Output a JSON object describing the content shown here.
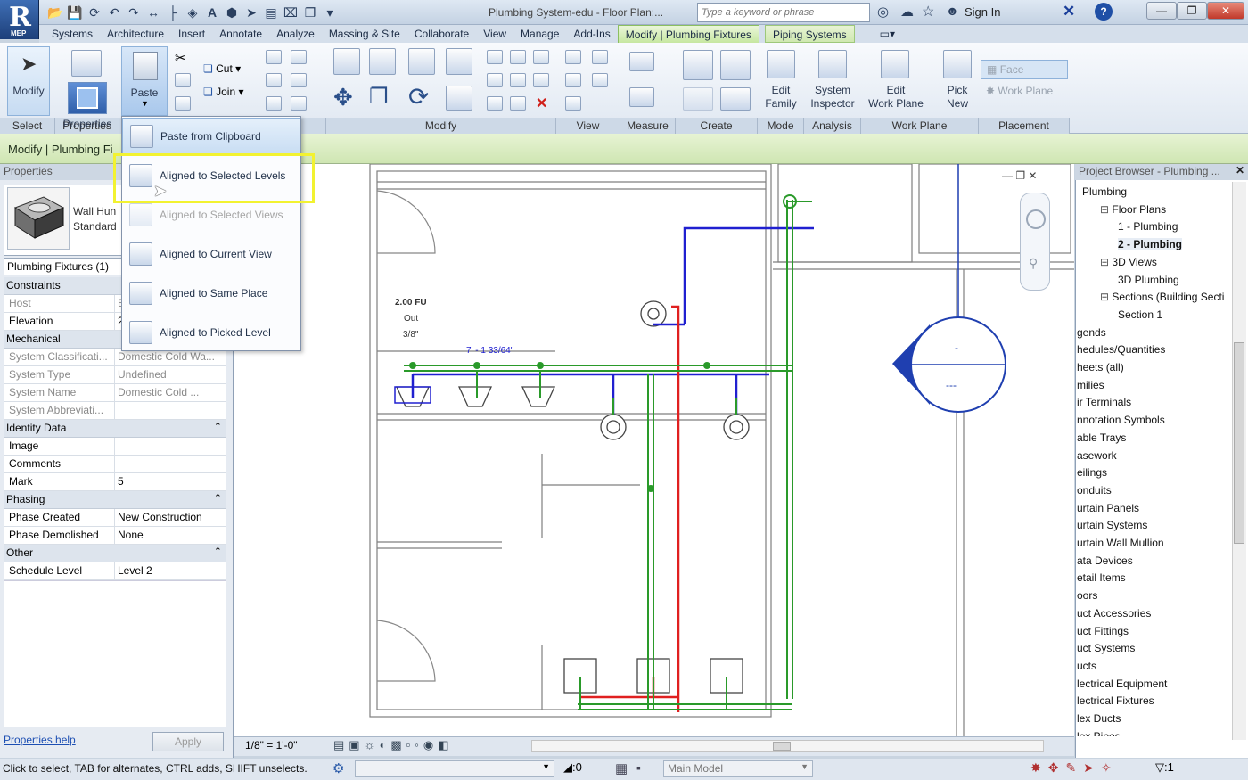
{
  "app": {
    "logo_letter": "R",
    "logo_caption": "MEP"
  },
  "title_bar": {
    "document_title": "Plumbing System-edu - Floor Plan:...",
    "search_placeholder": "Type a keyword or phrase",
    "sign_in": "Sign In",
    "qat_icons": [
      "open-icon",
      "save-icon",
      "sync-icon",
      "undo-icon",
      "redo-icon",
      "measure-icon",
      "dimension-icon",
      "tag-icon",
      "text-icon",
      "3d-view-icon",
      "section-icon",
      "thin-lines-icon",
      "close-hidden-icon",
      "switch-windows-icon",
      "customize-icon"
    ]
  },
  "tabs": [
    "Systems",
    "Architecture",
    "Insert",
    "Annotate",
    "Analyze",
    "Massing & Site",
    "Collaborate",
    "View",
    "Manage",
    "Add-Ins"
  ],
  "context_tabs": {
    "active": "Modify | Plumbing Fixtures",
    "secondary": "Piping Systems"
  },
  "ribbon": {
    "select": {
      "modify": "Modify",
      "label": "Select"
    },
    "properties": {
      "button": "Properties",
      "label": "Properties"
    },
    "clipboard": {
      "paste": "Paste",
      "cut": "Cut",
      "join": "Join"
    },
    "panels": {
      "modify": "Modify",
      "view": "View",
      "measure": "Measure",
      "create": "Create",
      "mode": "Mode",
      "analysis": "Analysis",
      "work_plane": "Work Plane",
      "placement": "Placement"
    },
    "mode_btn": [
      "Edit",
      "Family"
    ],
    "analysis_btn": [
      "System",
      "Inspector"
    ],
    "workplane_btn": [
      "Edit",
      "Work Plane"
    ],
    "pick_btn": [
      "Pick",
      "New"
    ],
    "placement_face": "Face",
    "placement_workplane": "Work Plane"
  },
  "options_bar": {
    "title": "Modify | Plumbing Fi"
  },
  "paste_menu": {
    "items": [
      {
        "label": "Paste from Clipboard",
        "enabled": true
      },
      {
        "label": "Aligned to Selected Levels",
        "enabled": true
      },
      {
        "label": "Aligned to Selected Views",
        "enabled": false
      },
      {
        "label": "Aligned to Current View",
        "enabled": true
      },
      {
        "label": "Aligned to Same Place",
        "enabled": true
      },
      {
        "label": "Aligned to Picked Level",
        "enabled": true
      }
    ]
  },
  "properties": {
    "header": "Properties",
    "type_name_line1": "Wall Hun",
    "type_name_line2": "Standard",
    "selector": "Plumbing Fixtures (1)",
    "groups": {
      "constraints": "Constraints",
      "mechanical": "Mechanical",
      "identity": "Identity Data",
      "phasing": "Phasing",
      "other": "Other"
    },
    "rows": {
      "host": {
        "k": "Host",
        "v": "E"
      },
      "elevation": {
        "k": "Elevation",
        "v": "2"
      },
      "sys_class": {
        "k": "System Classificati...",
        "v": "Domestic Cold Wa..."
      },
      "sys_type": {
        "k": "System Type",
        "v": "Undefined"
      },
      "sys_name": {
        "k": "System Name",
        "v": "Domestic Cold ..."
      },
      "sys_abbrev": {
        "k": "System Abbreviati...",
        "v": ""
      },
      "image": {
        "k": "Image",
        "v": ""
      },
      "comments": {
        "k": "Comments",
        "v": ""
      },
      "mark": {
        "k": "Mark",
        "v": "5"
      },
      "phase_created": {
        "k": "Phase Created",
        "v": "New Construction"
      },
      "phase_demolished": {
        "k": "Phase Demolished",
        "v": "None"
      },
      "schedule_level": {
        "k": "Schedule Level",
        "v": "Level 2"
      }
    },
    "help_link": "Properties help",
    "apply": "Apply"
  },
  "drawing": {
    "fu_label": "2.00 FU",
    "out_label": "Out",
    "size_label": "3/8\"",
    "dim_label": "7' - 1 33/64\"",
    "elev_tag_top": "-",
    "elev_tag_bottom": "---"
  },
  "view_bar": {
    "scale": "1/8\" = 1'-0\""
  },
  "browser": {
    "header": "Project Browser - Plumbing ...",
    "tree": [
      {
        "label": "Plumbing",
        "indent": 0
      },
      {
        "label": "Floor Plans",
        "indent": 1
      },
      {
        "label": "1 - Plumbing",
        "indent": 2
      },
      {
        "label": "2 - Plumbing",
        "indent": 2,
        "bold": true
      },
      {
        "label": "3D Views",
        "indent": 1
      },
      {
        "label": "3D Plumbing",
        "indent": 2
      },
      {
        "label": "Sections (Building Secti",
        "indent": 1
      },
      {
        "label": "Section 1",
        "indent": 2
      }
    ],
    "families": [
      "gends",
      "hedules/Quantities",
      "heets (all)",
      "milies",
      "ir Terminals",
      "nnotation Symbols",
      "able Trays",
      "asework",
      "eilings",
      "onduits",
      "urtain Panels",
      "urtain Systems",
      "urtain Wall Mullion",
      "ata Devices",
      "etail Items",
      "oors",
      "uct Accessories",
      "uct Fittings",
      "uct Systems",
      "ucts",
      "lectrical Equipment",
      "lectrical Fixtures",
      "lex Ducts",
      "lex Pipes"
    ]
  },
  "status_bar": {
    "text": "Click to select, TAB for alternates, CTRL adds, SHIFT unselects.",
    "filter_count": ":0",
    "model": "Main Model",
    "selection_count": ":1"
  },
  "colors": {
    "ribbon_ctx": "#cfe8b0",
    "highlight": "#f2f230",
    "pipe_green": "#2a9a2a",
    "pipe_red": "#e02020",
    "pipe_blue": "#2020d0"
  }
}
